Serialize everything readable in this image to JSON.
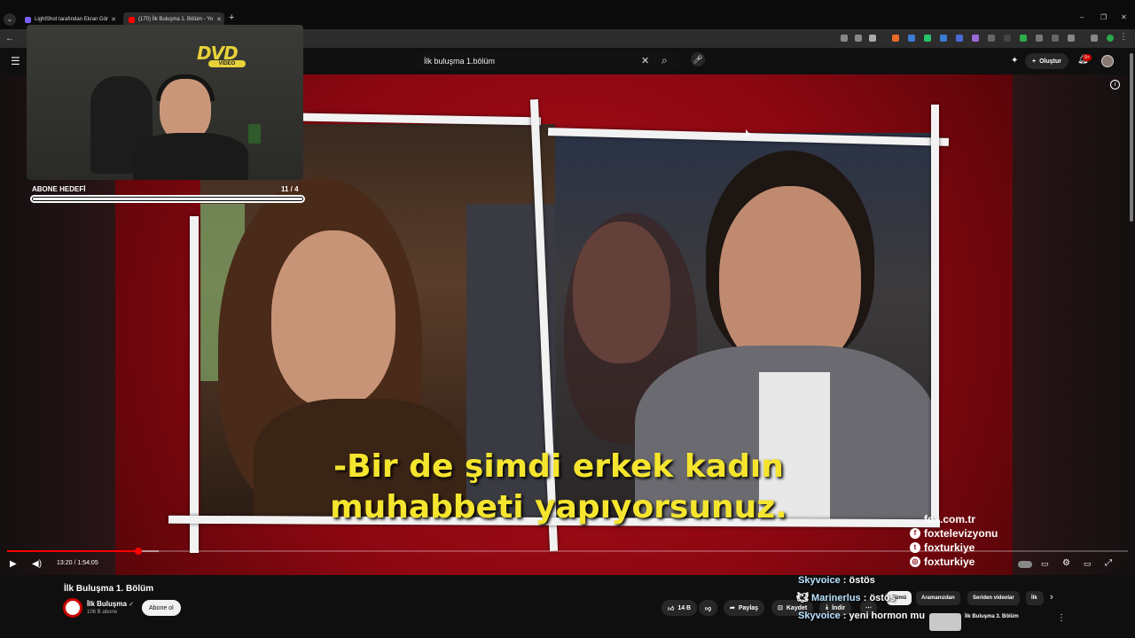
{
  "browser": {
    "tabs": [
      {
        "title": "LightShot tarafından Ekran Gör",
        "favicon_color": "#7b61ff"
      },
      {
        "title": "(170) İlk Buluşma 1. Bölüm - Yo",
        "favicon_color": "#ff0000"
      }
    ],
    "window_controls": [
      "–",
      "❐",
      "✕"
    ]
  },
  "youtube": {
    "search_value": "İlk buluşma 1.bölüm",
    "create_label": "Oluştur",
    "notifications_badge": "9+"
  },
  "stream_overlay": {
    "logo_text": "DVD",
    "logo_sub": "VIDEO",
    "goal_label": "ABONE HEDEFİ",
    "goal_count": "11  / 4",
    "goal_progress": 1.0
  },
  "video": {
    "subtitle_line1": "-Bir de şimdi erkek kadın",
    "subtitle_line2": "muhabbeti yapıyorsunuz.",
    "socials": [
      "fox.com.tr",
      "foxtelevizyonu",
      "foxturkiye",
      "foxturkiye"
    ],
    "time_display": "13:20 / 1:54:05",
    "progress": 0.117,
    "buffered": 0.135
  },
  "details": {
    "title": "İlk Buluşma 1. Bölüm",
    "channel": "İlk Buluşma",
    "subscribers": "106 B abone",
    "subscribe_label": "Abone ol",
    "likes": "14 B",
    "share_label": "Paylaş",
    "save_label": "Kaydet",
    "download_label": "İndir"
  },
  "chips": [
    "Tümü",
    "Aramanızdan",
    "Seriden videolar",
    "İlk"
  ],
  "chat": [
    {
      "user": "Skyvoice",
      "message": "östös"
    },
    {
      "user": "Marinerlus",
      "message": "östös"
    },
    {
      "user": "Skyvoice",
      "message": "yeni hormon mu"
    }
  ],
  "recommendation": {
    "title": "İlk Buluşma 3. Bölüm"
  },
  "colors": {
    "accent": "#ff0000",
    "subtitle": "#f5e52e",
    "frame_red": "#b10f19"
  }
}
